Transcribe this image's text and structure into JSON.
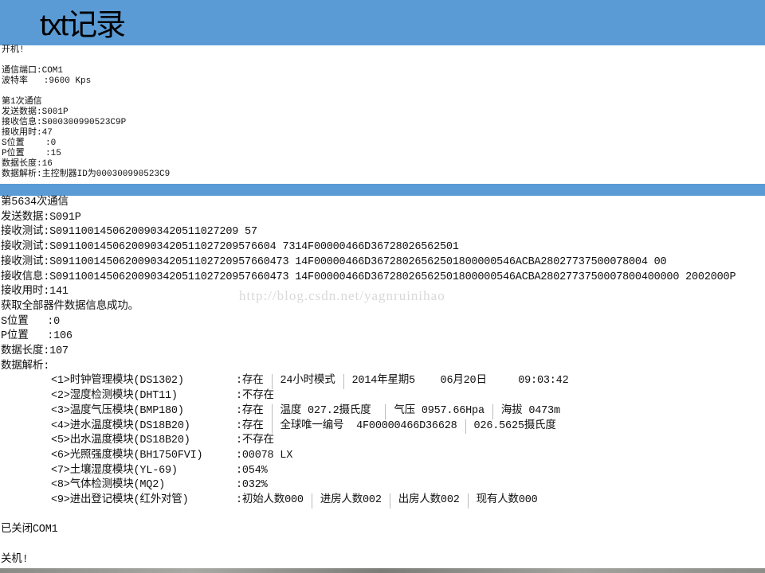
{
  "title": "txt记录",
  "log1": {
    "lines": [
      "开机!",
      "",
      "通信端口:COM1",
      "波特率   :9600 Kps",
      "",
      "第1次通信",
      "发送数据:S001P",
      "接收信息:S000300990523C9P",
      "接收用时:47",
      "S位置    :0",
      "P位置    :15",
      "数据长度:16",
      "数据解析:主控制器ID为000300990523C9"
    ]
  },
  "log2": {
    "lines": [
      "第5634次通信",
      "发送数据:S091P",
      "接收测试:S09110014506200903420511027209 57",
      "接收测试:S09110014506200903420511027209576604 7314F00000466D36728026562501",
      "接收测试:S0911001450620090342051102720957660473 14F00000466D36728026562501800000546ACBA28027737500078004 00",
      "接收信息:S0911001450620090342051102720957660473 14F00000466D36728026562501800000546ACBA2802773750007800400000 2002000P",
      "接收用时:141",
      "获取全部器件数据信息成功。",
      "S位置   :0",
      "P位置   :106",
      "数据长度:107",
      "数据解析:"
    ],
    "modules": [
      {
        "name": "<1>时钟管理模块(DS1302)",
        "values": [
          ":存在",
          "24小时模式",
          "2014年星期5    06月20日     09:03:42"
        ]
      },
      {
        "name": "<2>湿度检测模块(DHT11)",
        "values": [
          ":不存在"
        ]
      },
      {
        "name": "<3>温度气压模块(BMP180)",
        "values": [
          ":存在",
          "温度 027.2摄氏度 ",
          "气压 0957.66Hpa",
          "海拔 0473m"
        ]
      },
      {
        "name": "<4>进水温度模块(DS18B20)",
        "values": [
          ":存在",
          "全球唯一编号  4F00000466D36628",
          "026.5625摄氏度"
        ]
      },
      {
        "name": "<5>出水温度模块(DS18B20)",
        "values": [
          ":不存在"
        ]
      },
      {
        "name": "<6>光照强度模块(BH1750FVI)",
        "values": [
          ":00078 LX"
        ]
      },
      {
        "name": "<7>土壤湿度模块(YL-69)",
        "values": [
          ":054%"
        ]
      },
      {
        "name": "<8>气体检测模块(MQ2)",
        "values": [
          ":032%"
        ]
      },
      {
        "name": "<9>进出登记模块(红外对管)",
        "values": [
          ":初始人数000",
          "进房人数002",
          "出房人数002",
          "现有人数000"
        ]
      }
    ],
    "closed": "已关闭COM1",
    "shutdown": "关机!"
  },
  "watermark": "http://blog.csdn.net/yagnruinihao",
  "colors": {
    "accent": "#5b9bd5"
  }
}
